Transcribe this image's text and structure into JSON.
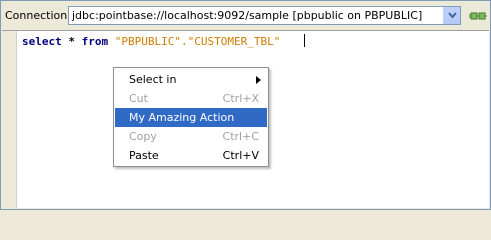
{
  "toolbar": {
    "connection_label": "Connection:",
    "connection_value": "jdbc:pointbase://localhost:9092/sample [pbpublic on PBPUBLIC]"
  },
  "editor": {
    "keyword_select": "select",
    "star": " * ",
    "keyword_from": "from",
    "space": " ",
    "schema": "\"PBPUBLIC\"",
    "dot": ".",
    "table": "\"CUSTOMER_TBL\""
  },
  "context_menu": {
    "items": [
      {
        "label": "Select in",
        "accelerator": "",
        "state": "enabled",
        "submenu": true
      },
      {
        "label": "Cut",
        "accelerator": "Ctrl+X",
        "state": "disabled"
      },
      {
        "label": "My Amazing Action",
        "accelerator": "",
        "state": "selected"
      },
      {
        "label": "Copy",
        "accelerator": "Ctrl+C",
        "state": "disabled"
      },
      {
        "label": "Paste",
        "accelerator": "Ctrl+V",
        "state": "enabled"
      }
    ]
  },
  "icons": {
    "dropdown": "chevron-down-icon",
    "connect": "plug-connect-icon",
    "submenu": "triangle-right-icon"
  },
  "colors": {
    "keyword": "#000080",
    "string": "#ce7b00",
    "selection": "#316ac5",
    "disabled_text": "#a0a0a0"
  }
}
